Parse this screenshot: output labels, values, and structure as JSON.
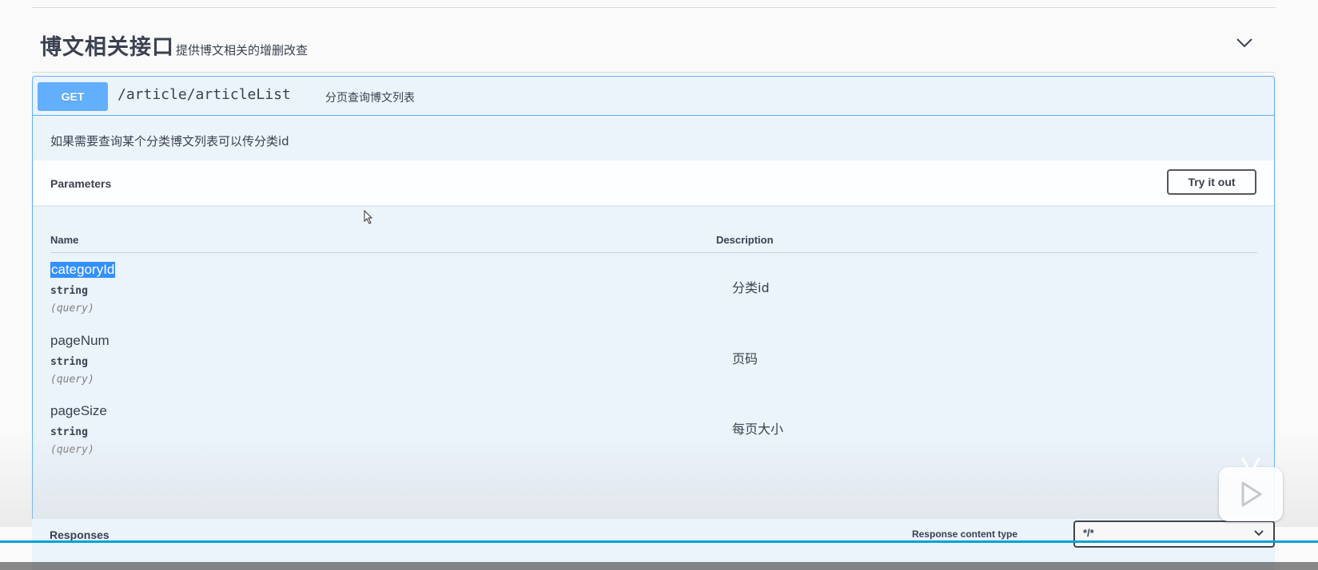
{
  "tag": {
    "title": "博文相关接口",
    "description": "提供博文相关的增删改查"
  },
  "operation": {
    "method": "GET",
    "path": "/article/articleList",
    "summary": "分页查询博文列表",
    "description": "如果需要查询某个分类博文列表可以传分类id"
  },
  "parameters": {
    "title": "Parameters",
    "try_it_out_label": "Try it out",
    "columns": {
      "name": "Name",
      "description": "Description"
    },
    "items": [
      {
        "name": "categoryId",
        "type": "string",
        "in": "(query)",
        "description": "分类id",
        "selected": true
      },
      {
        "name": "pageNum",
        "type": "string",
        "in": "(query)",
        "description": "页码",
        "selected": false
      },
      {
        "name": "pageSize",
        "type": "string",
        "in": "(query)",
        "description": "每页大小",
        "selected": false
      }
    ]
  },
  "responses": {
    "title": "Responses",
    "content_type_label": "Response content type",
    "content_type_value": "*/*"
  },
  "player": {
    "progress": 1.0,
    "accent_color": "#00a1d6"
  },
  "colors": {
    "get_method": "#61affe",
    "opblock_bg": "#ebf3fb",
    "selection": "#3390ff"
  }
}
